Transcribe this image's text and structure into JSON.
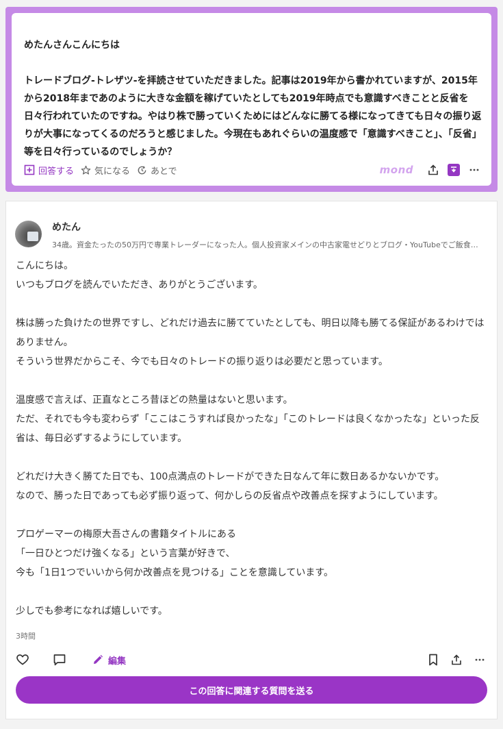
{
  "question": {
    "greeting": "めたんさんこんにちは",
    "body": "トレードブログ-トレザツ-を拝読させていただきました。記事は2019年から書かれていますが、2015年から2018年まであのように大きな金額を稼げていたとしても2019年時点でも意識すべきことと反省を日々行われていたのですね。やはり株で勝っていくためにはどんなに勝てる様になってきても日々の振り返りが大事になってくるのだろうと感じました。今現在もあれぐらいの温度感で「意識すべきこと」、「反省」等を日々行っているのでしょうか？",
    "actions": {
      "answer_label": "回答する",
      "interest_label": "気になる",
      "later_label": "あとで"
    },
    "logo_text": "mond"
  },
  "answer": {
    "author_name": "めたん",
    "author_bio": "34歳。資金たったの50万円で専業トレーダーになった人。個人投資家メインの中古家電せどりとブログ・YouTubeでご飯食べています。…",
    "paragraphs": [
      "こんにちは。",
      "いつもブログを読んでいただき、ありがとうございます。",
      "",
      "株は勝った負けたの世界ですし、どれだけ過去に勝てていたとしても、明日以降も勝てる保証があるわけではありません。",
      "そういう世界だからこそ、今でも日々のトレードの振り返りは必要だと思っています。",
      "",
      "温度感で言えば、正直なところ昔ほどの熱量はないと思います。",
      "ただ、それでも今も変わらず「ここはこうすれば良かったな」「このトレードは良くなかったな」といった反省は、毎日必ずするようにしています。",
      "",
      "どれだけ大きく勝てた日でも、100点満点のトレードができた日なんて年に数日あるかないかです。",
      "なので、勝った日であっても必ず振り返って、何かしらの反省点や改善点を探すようにしています。",
      "",
      "プロゲーマーの梅原大吾さんの書籍タイトルにある",
      "「一日ひとつだけ強くなる」という言葉が好きで、",
      "今も「1日1つでいいから何か改善点を見つける」ことを意識しています。",
      "",
      "少しでも参考になれば嬉しいです。"
    ],
    "time": "3時間",
    "edit_label": "編集",
    "cta_label": "この回答に関連する質問を送る"
  },
  "colors": {
    "accent": "#9a35c6",
    "frame": "#c58ae6"
  }
}
